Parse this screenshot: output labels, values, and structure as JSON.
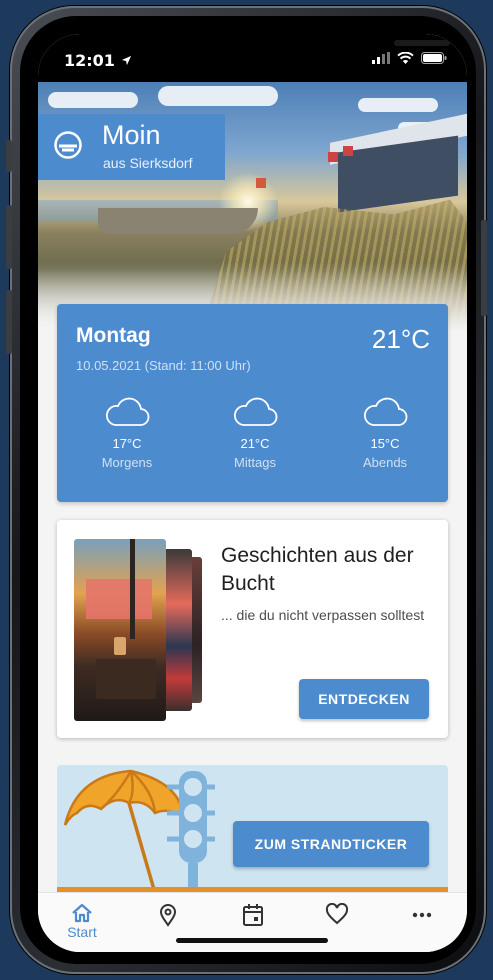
{
  "status_bar": {
    "time": "12:01",
    "icons": [
      "location-arrow-icon",
      "signal-icon",
      "wifi-icon",
      "battery-icon"
    ]
  },
  "greeting": {
    "title": "Moin",
    "subtitle": "aus Sierksdorf",
    "icon": "hat-icon"
  },
  "weather": {
    "day": "Montag",
    "date": "10.05.2021 (Stand: 11:00 Uhr)",
    "current_temp": "21°C",
    "slots": [
      {
        "temp": "17°C",
        "label": "Morgens",
        "icon": "cloud-icon"
      },
      {
        "temp": "21°C",
        "label": "Mittags",
        "icon": "cloud-icon"
      },
      {
        "temp": "15°C",
        "label": "Abends",
        "icon": "cloud-icon"
      }
    ]
  },
  "story": {
    "title": "Geschichten aus der Bucht",
    "description": "... die du nicht verpassen solltest",
    "button": "ENTDECKEN"
  },
  "beach_ticker": {
    "button": "ZUM STRANDTICKER"
  },
  "tab_bar": {
    "tabs": [
      {
        "label": "Start",
        "icon": "home-icon",
        "active": true
      },
      {
        "label": "",
        "icon": "map-pin-icon",
        "active": false
      },
      {
        "label": "",
        "icon": "calendar-icon",
        "active": false
      },
      {
        "label": "",
        "icon": "heart-icon",
        "active": false
      },
      {
        "label": "",
        "icon": "more-icon",
        "active": false
      }
    ]
  },
  "colors": {
    "accent": "#4d8bcf",
    "beach_background": "#cfe4f1",
    "beach_stripe": "#e39126",
    "umbrella": "#f0a52a",
    "traffic_light": "#7fb3dc"
  }
}
